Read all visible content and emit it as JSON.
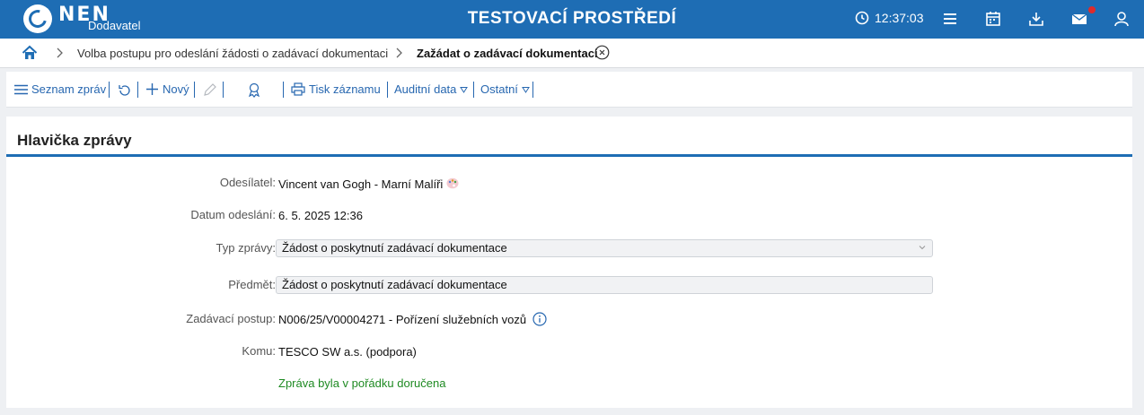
{
  "header": {
    "logo_text": "NEN",
    "logo_sub": "Dodavatel",
    "env_title": "TESTOVACÍ PROSTŘEDÍ",
    "clock": "12:37:03",
    "icons": [
      "clock-icon",
      "menu-icon",
      "calendar-icon",
      "download-icon",
      "mail-icon",
      "user-icon"
    ]
  },
  "breadcrumb": {
    "items": [
      "Volba postupu pro odeslání žádosti o zadávací dokumentaci",
      "Zažádat o zadávací dokumentaci"
    ]
  },
  "toolbar": {
    "list_label": "Seznam zpráv",
    "new_label": "Nový",
    "print_label": "Tisk záznamu",
    "audit_label": "Auditní data",
    "other_label": "Ostatní"
  },
  "form": {
    "title": "Hlavička zprávy",
    "sender_label": "Odesílatel:",
    "sender_value": "Vincent van Gogh - Marní Malíři",
    "date_label": "Datum odeslání:",
    "date_value": "6. 5. 2025 12:36",
    "type_label": "Typ zprávy:",
    "type_value": "Žádost o poskytnutí zadávací dokumentace",
    "subject_label": "Předmět:",
    "subject_value": "Žádost o poskytnutí zadávací dokumentace",
    "procedure_label": "Zadávací postup:",
    "procedure_value": "N006/25/V00004271 - Pořízení služebních vozů",
    "to_label": "Komu:",
    "to_value": "TESCO SW a.s. (podpora)",
    "status_message": "Zpráva byla v pořádku doručena"
  },
  "colors": {
    "primary": "#1e6db4",
    "link": "#2767b0",
    "success": "#1e8a22",
    "notification": "#e02b2b"
  }
}
